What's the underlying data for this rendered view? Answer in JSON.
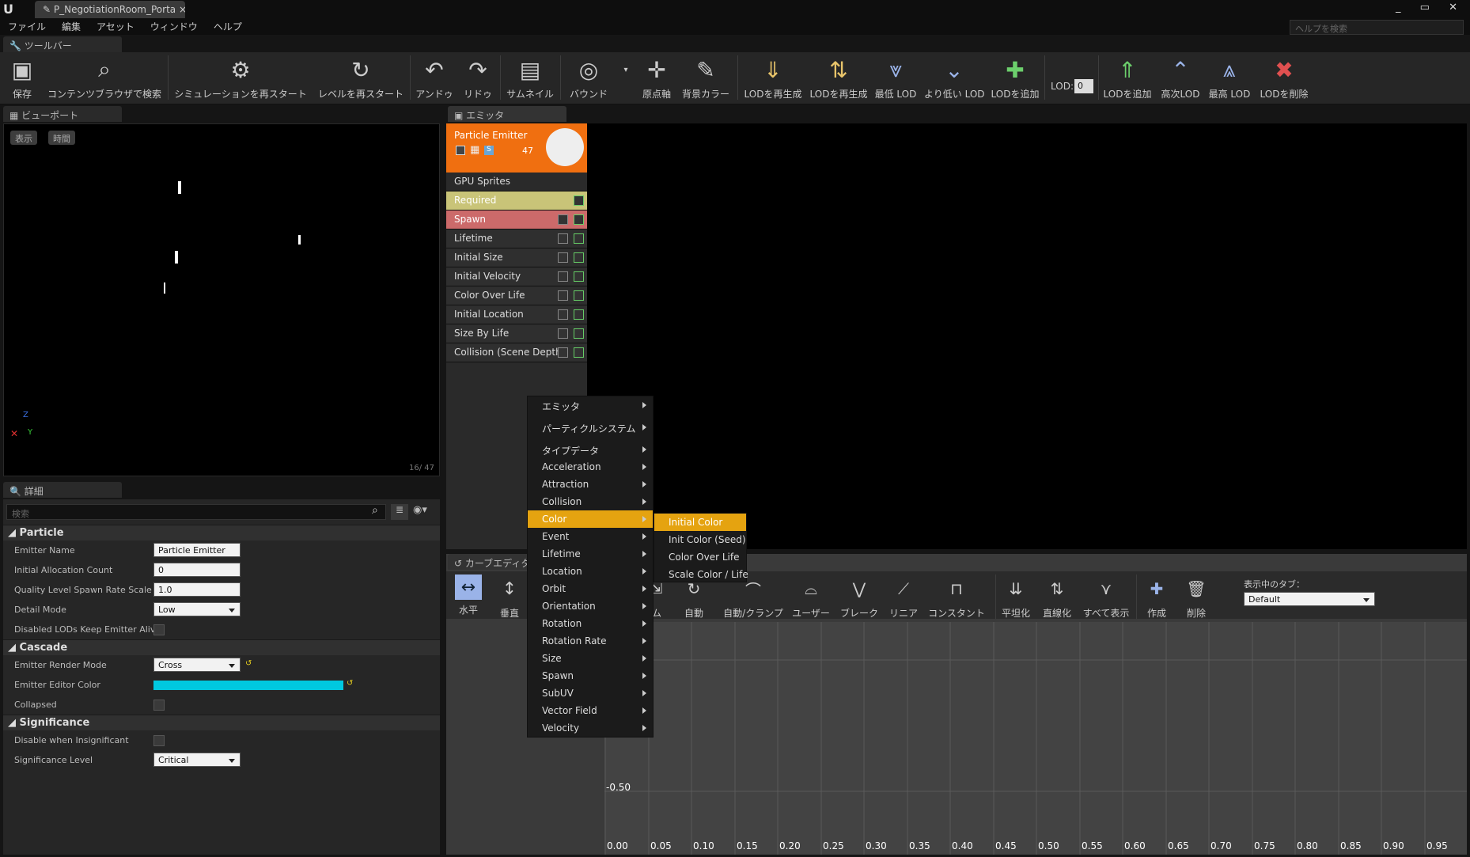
{
  "window": {
    "tab": "P_NegotiationRoom_Porta",
    "help_placeholder": "ヘルプを検索"
  },
  "menu": [
    "ファイル",
    "編集",
    "アセット",
    "ウィンドウ",
    "ヘルプ"
  ],
  "toolbar_tab": "ツールバー",
  "toolbar": {
    "items": [
      {
        "label": "保存",
        "icon": "save-icon"
      },
      {
        "label": "コンテンツブラウザで検索",
        "icon": "search-icon"
      },
      {
        "label": "シミュレーションを再スタート",
        "icon": "gear-icon"
      },
      {
        "label": "レベルを再スタート",
        "icon": "restart-icon"
      },
      {
        "label": "アンドゥ",
        "icon": "undo-icon"
      },
      {
        "label": "リドゥ",
        "icon": "redo-icon"
      },
      {
        "label": "サムネイル",
        "icon": "thumbnail-icon"
      },
      {
        "label": "バウンド",
        "icon": "bounds-icon"
      },
      {
        "label": "原点軸",
        "icon": "axis-icon"
      },
      {
        "label": "背景カラー",
        "icon": "brush-icon"
      },
      {
        "label": "LODを再生成",
        "icon": "lod-regen-icon"
      },
      {
        "label": "LODを再生成",
        "icon": "lod-regen2-icon"
      },
      {
        "label": "最低 LOD",
        "icon": "lowest-lod-icon"
      },
      {
        "label": "より低い LOD",
        "icon": "lower-lod-icon"
      },
      {
        "label": "LODを追加",
        "icon": "add-lod-icon"
      },
      {
        "label": "LODを追加",
        "icon": "add-lod2-icon"
      },
      {
        "label": "高次LOD",
        "icon": "higher-lod-icon"
      },
      {
        "label": "最高 LOD",
        "icon": "highest-lod-icon"
      },
      {
        "label": "LODを削除",
        "icon": "delete-lod-icon"
      }
    ],
    "lod_label": "LOD:",
    "lod_value": "0"
  },
  "viewport": {
    "tab": "ビューポート",
    "btn_show": "表示",
    "btn_time": "時間",
    "count": "16/  47",
    "axis_z": "Z",
    "axis_y": "Y"
  },
  "details": {
    "tab": "詳細",
    "search_placeholder": "検索",
    "sections": {
      "particle": "Particle",
      "cascade": "Cascade",
      "significance": "Significance"
    },
    "props": {
      "emitter_name_l": "Emitter Name",
      "emitter_name_v": "Particle Emitter",
      "alloc_l": "Initial Allocation Count",
      "alloc_v": "0",
      "quality_l": "Quality Level Spawn Rate Scale",
      "quality_v": "1.0",
      "detail_l": "Detail Mode",
      "detail_v": "Low",
      "disabled_l": "Disabled LODs Keep Emitter Alive",
      "render_l": "Emitter Render Mode",
      "render_v": "Cross",
      "editorcolor_l": "Emitter Editor Color",
      "editorcolor": "#00c8e0",
      "collapsed_l": "Collapsed",
      "insig_l": "Disable when Insignificant",
      "siglevel_l": "Significance Level",
      "siglevel_v": "Critical"
    }
  },
  "emitter": {
    "tab": "エミッタ",
    "name": "Particle Emitter",
    "count": "47",
    "type": "GPU Sprites",
    "modules": [
      "Required",
      "Spawn",
      "Lifetime",
      "Initial Size",
      "Initial Velocity",
      "Color Over Life",
      "Initial Location",
      "Size By Life",
      "Collision (Scene Depth)"
    ]
  },
  "curve": {
    "tab": "カーブエディタ",
    "tools": [
      "水平",
      "垂直",
      "ム",
      "自動",
      "自動/クランプ",
      "ユーザー",
      "ブレーク",
      "リニア",
      "コンスタント",
      "平坦化",
      "直線化",
      "すべて表示",
      "作成",
      "削除"
    ],
    "tab_label": "表示中のタブ：",
    "tab_value": "Default",
    "y_label": "-0.50",
    "x_ticks": [
      "0.00",
      "0.05",
      "0.10",
      "0.15",
      "0.20",
      "0.25",
      "0.30",
      "0.35",
      "0.40",
      "0.45",
      "0.50",
      "0.55",
      "0.60",
      "0.65",
      "0.70",
      "0.75",
      "0.80",
      "0.85",
      "0.90",
      "0.95"
    ]
  },
  "context_menu": {
    "items": [
      "エミッタ",
      "パーティクルシステム",
      "タイプデータ",
      "Acceleration",
      "Attraction",
      "Collision",
      "Color",
      "Event",
      "Lifetime",
      "Location",
      "Orbit",
      "Orientation",
      "Rotation",
      "Rotation Rate",
      "Size",
      "Spawn",
      "SubUV",
      "Vector Field",
      "Velocity"
    ],
    "submenu": [
      "Initial Color",
      "Init Color (Seed)",
      "Color Over Life",
      "Scale Color / Life"
    ]
  }
}
